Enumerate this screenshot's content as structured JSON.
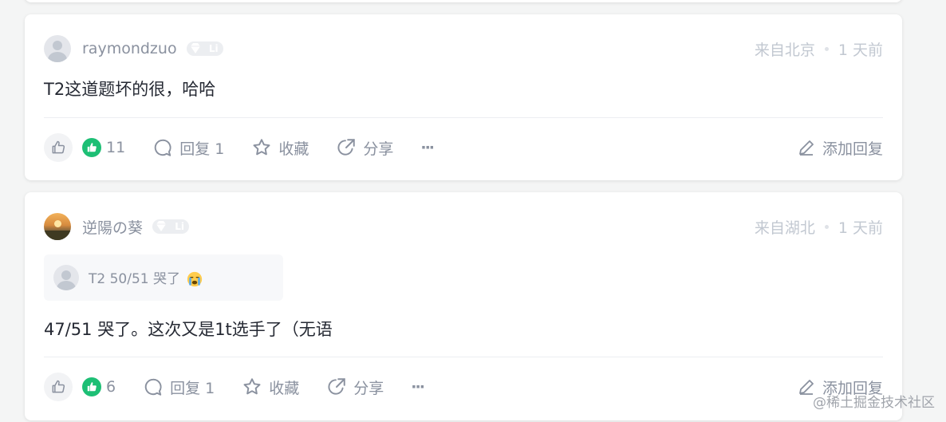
{
  "comments": [
    {
      "username": "raymondzuo",
      "level": "Li",
      "location": "来自北京",
      "time": "1 天前",
      "quote": null,
      "content": "T2这道题坏的很，哈哈",
      "likes": "11",
      "reply_label": "回复 1",
      "favorite_label": "收藏",
      "share_label": "分享",
      "more_label": "···",
      "add_reply_label": "添加回复",
      "avatar": "default"
    },
    {
      "username": "逆陽の葵",
      "level": "Li",
      "location": "来自湖北",
      "time": "1 天前",
      "quote": "T2 50/51 哭了",
      "content": "47/51 哭了。这次又是1t选手了（无语",
      "likes": "6",
      "reply_label": "回复 1",
      "favorite_label": "收藏",
      "share_label": "分享",
      "more_label": "···",
      "add_reply_label": "添加回复",
      "avatar": "sunset-photo"
    }
  ],
  "icons": {
    "like": "thumb-up-icon",
    "liked": "thumb-up-filled-icon",
    "reply": "comment-bubble-icon",
    "favorite": "star-icon",
    "share": "share-arrow-icon",
    "more": "more-dots-icon",
    "add_reply": "pencil-icon",
    "quote_emoji": "crying-face-icon"
  },
  "colors": {
    "liked_green": "#1dbf75",
    "muted_text": "#8a919f",
    "primary_text": "#252933"
  },
  "watermark": "@稀土掘金技术社区"
}
